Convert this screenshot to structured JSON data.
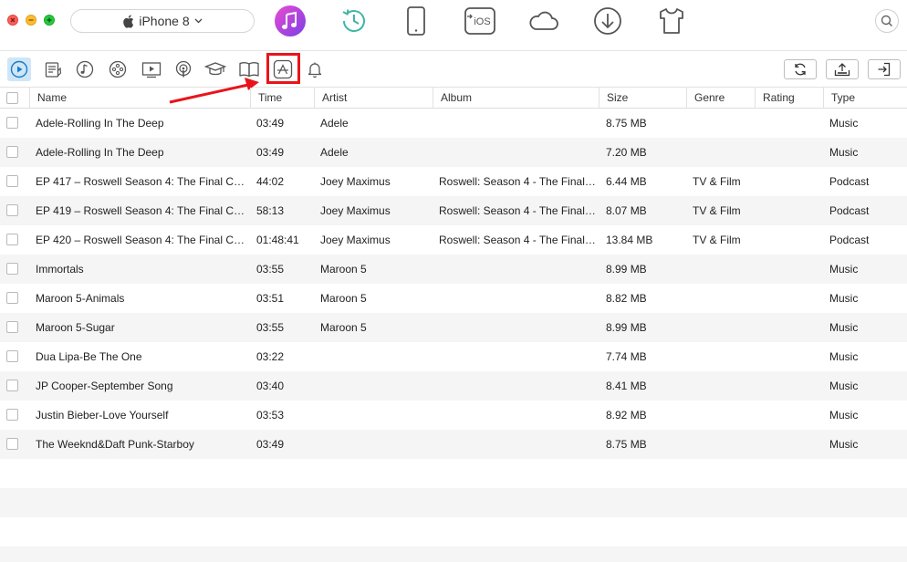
{
  "device": {
    "name": "iPhone 8"
  },
  "top_tools": [
    {
      "name": "music-app-icon"
    },
    {
      "name": "backup-history-icon"
    },
    {
      "name": "phone-device-icon"
    },
    {
      "name": "to-ios-icon",
      "label": "iOS"
    },
    {
      "name": "cloud-icon"
    },
    {
      "name": "download-icon"
    },
    {
      "name": "tshirt-ringtone-icon"
    }
  ],
  "categories": [
    {
      "name": "audio-play-icon",
      "active": true
    },
    {
      "name": "playlist-icon"
    },
    {
      "name": "ringtone-icon"
    },
    {
      "name": "voice-memo-icon"
    },
    {
      "name": "video-icon"
    },
    {
      "name": "podcast-icon"
    },
    {
      "name": "itunes-u-icon"
    },
    {
      "name": "audiobook-icon"
    },
    {
      "name": "app-store-icon",
      "highlighted": true
    },
    {
      "name": "notification-icon"
    }
  ],
  "actions": [
    {
      "name": "refresh-icon"
    },
    {
      "name": "import-to-device-icon"
    },
    {
      "name": "export-to-mac-icon"
    }
  ],
  "accent_color": "#e8141a",
  "table": {
    "columns": [
      "Name",
      "Time",
      "Artist",
      "Album",
      "Size",
      "Genre",
      "Rating",
      "Type"
    ],
    "rows": [
      [
        "Adele-Rolling In The Deep",
        "03:49",
        "Adele",
        "",
        "8.75 MB",
        "",
        "",
        "Music"
      ],
      [
        "Adele-Rolling In The Deep",
        "03:49",
        "Adele",
        "",
        "7.20 MB",
        "",
        "",
        "Music"
      ],
      [
        "EP 417 – Roswell Season 4: The Final Ch…",
        "44:02",
        "Joey Maximus",
        "Roswell: Season 4 - The Final…",
        "6.44 MB",
        "TV & Film",
        "",
        "Podcast"
      ],
      [
        "EP 419 – Roswell Season 4: The Final Ch…",
        "58:13",
        "Joey Maximus",
        "Roswell: Season 4 - The Final…",
        "8.07 MB",
        "TV & Film",
        "",
        "Podcast"
      ],
      [
        "EP 420 – Roswell Season 4: The Final Ch…",
        "01:48:41",
        "Joey Maximus",
        "Roswell: Season 4 - The Final…",
        "13.84 MB",
        "TV & Film",
        "",
        "Podcast"
      ],
      [
        "Immortals",
        "03:55",
        "Maroon 5",
        "",
        "8.99 MB",
        "",
        "",
        "Music"
      ],
      [
        "Maroon 5-Animals",
        "03:51",
        "Maroon 5",
        "",
        "8.82 MB",
        "",
        "",
        "Music"
      ],
      [
        "Maroon 5-Sugar",
        "03:55",
        "Maroon 5",
        "",
        "8.99 MB",
        "",
        "",
        "Music"
      ],
      [
        "Dua Lipa-Be The One",
        "03:22",
        "",
        "",
        "7.74 MB",
        "",
        "",
        "Music"
      ],
      [
        "JP Cooper-September Song",
        "03:40",
        "",
        "",
        "8.41 MB",
        "",
        "",
        "Music"
      ],
      [
        "Justin Bieber-Love Yourself",
        "03:53",
        "",
        "",
        "8.92 MB",
        "",
        "",
        "Music"
      ],
      [
        "The Weeknd&Daft Punk-Starboy",
        "03:49",
        "",
        "",
        "8.75 MB",
        "",
        "",
        "Music"
      ]
    ]
  }
}
